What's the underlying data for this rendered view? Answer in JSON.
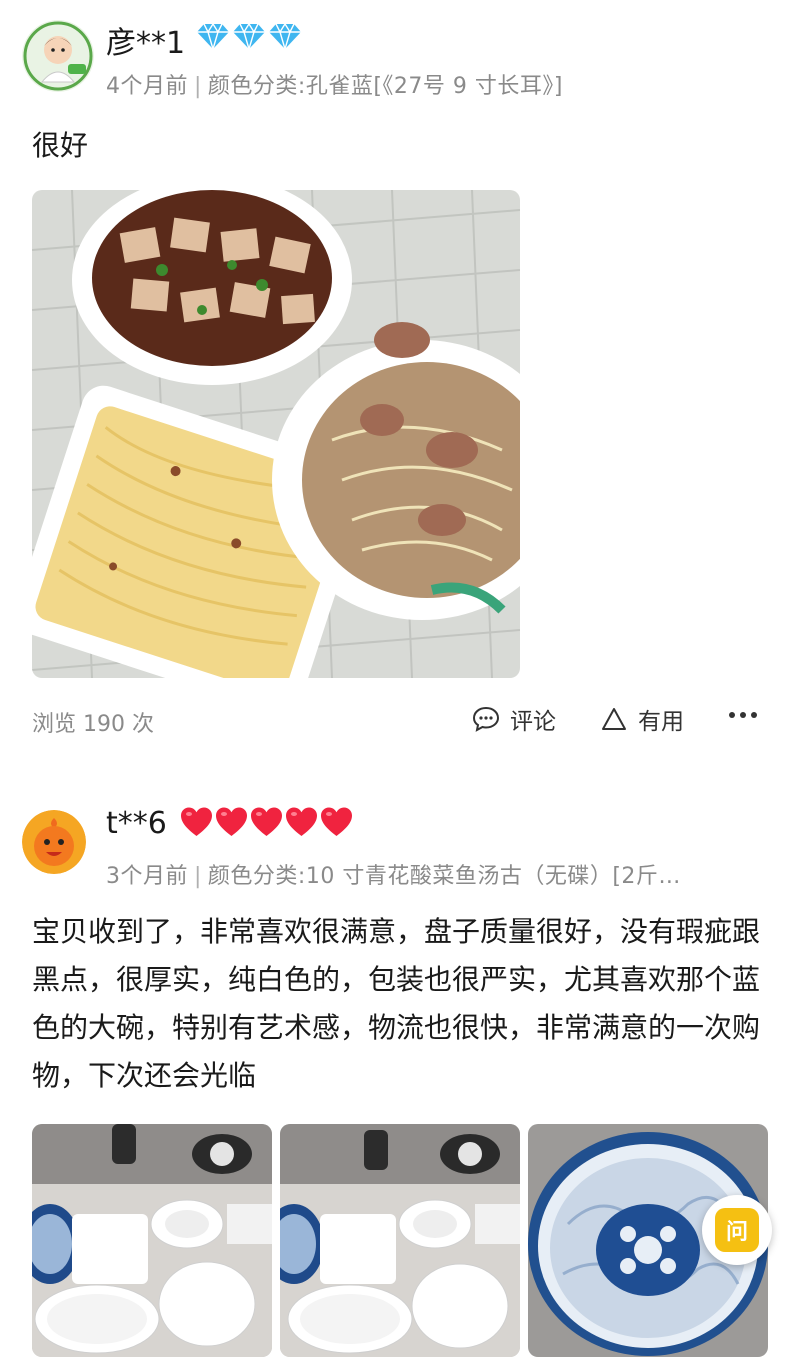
{
  "reviews": [
    {
      "username": "彦**1",
      "badge": "diamond",
      "badge_count": 3,
      "time": "4个月前",
      "sku": "颜色分类:孔雀蓝[《27号 9 寸长耳》]",
      "content": "很好",
      "views": "浏览 190 次",
      "comment_label": "评论",
      "useful_label": "有用",
      "more_icon": "more-dots-icon"
    },
    {
      "username": "t**6",
      "badge": "heart",
      "badge_count": 5,
      "time": "3个月前",
      "sku": "颜色分类:10 寸青花酸菜鱼汤古（无碟）[2斤…",
      "content": "宝贝收到了，非常喜欢很满意，盘子质量很好，没有瑕疵跟黑点，很厚实，纯白色的，包装也很严实，尤其喜欢那个蓝色的大碗，特别有艺术感，物流也很快，非常满意的一次购物，下次还会光临",
      "ask_label": "问"
    }
  ],
  "colors": {
    "diamond": "#3fb6f0",
    "heart": "#f0233f",
    "meta_gray": "#8a8a8a",
    "ask_yellow": "#f5c012"
  }
}
